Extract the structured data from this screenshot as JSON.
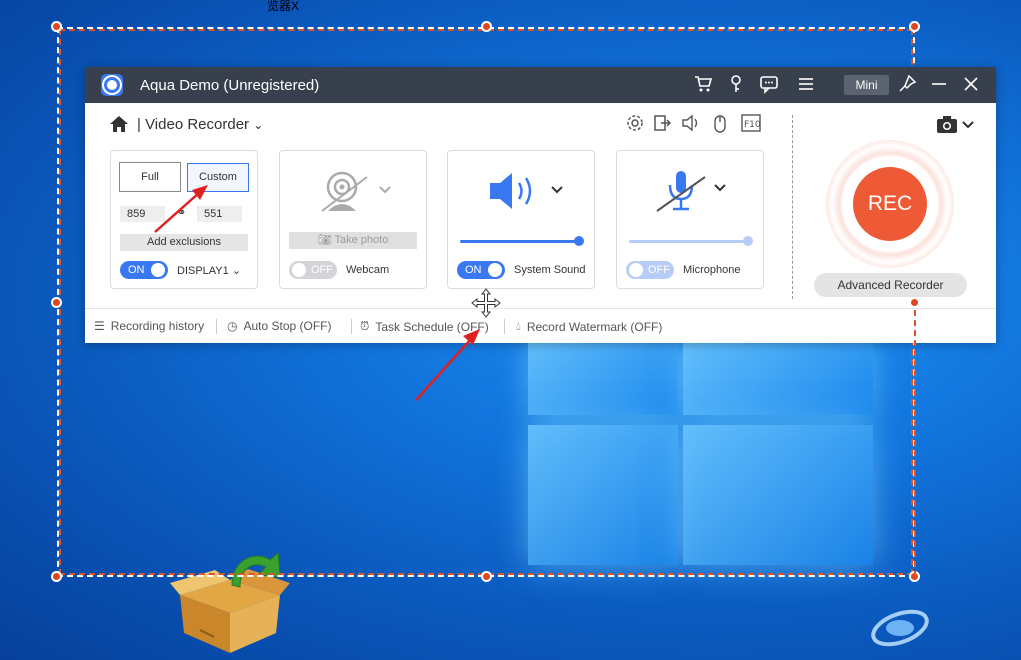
{
  "desktop": {
    "top_caption": "览器X"
  },
  "app": {
    "title": "Aqua Demo (Unregistered)",
    "mini_label": "Mini",
    "section_title": "Video Recorder"
  },
  "display_card": {
    "full_label": "Full",
    "custom_label": "Custom",
    "width": "859",
    "height": "551",
    "add_exclusions_label": "Add exclusions",
    "toggle_label": "ON",
    "display_name": "DISPLAY1"
  },
  "webcam_card": {
    "take_photo_label": "Take photo",
    "toggle_label": "OFF",
    "name": "Webcam"
  },
  "sound_card": {
    "toggle_label": "ON",
    "name": "System Sound",
    "volume": 1.0
  },
  "mic_card": {
    "toggle_label": "OFF",
    "name": "Microphone",
    "volume": 1.0
  },
  "rec": {
    "button_label": "REC",
    "advanced_label": "Advanced Recorder"
  },
  "bottom_bar": {
    "history": "Recording history",
    "auto_stop": "Auto Stop (OFF)",
    "task_schedule": "Task Schedule (OFF)",
    "watermark": "Record Watermark (OFF)"
  },
  "colors": {
    "accent": "#3a78f2",
    "rec": "#ef5a36",
    "selection": "#d9532b",
    "titlebar": "#39404d"
  }
}
